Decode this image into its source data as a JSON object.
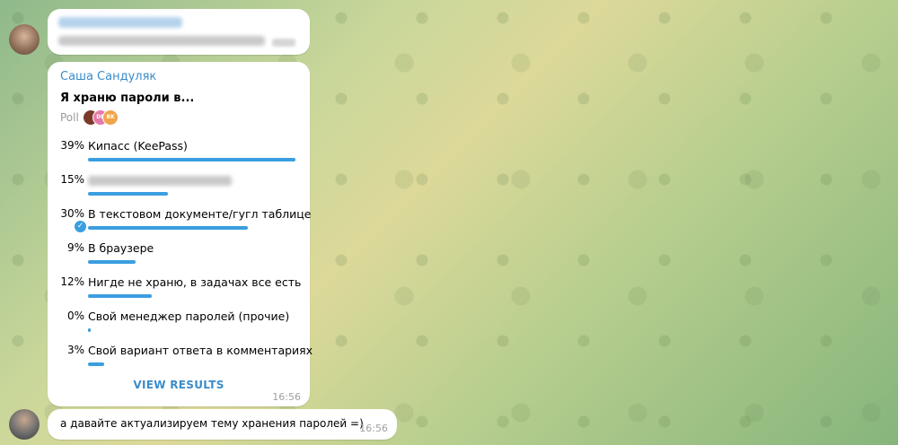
{
  "messages": {
    "prev": {},
    "poll": {
      "sender": "Саша Сандуляк",
      "question": "Я храню пароли в...",
      "type_label": "Poll",
      "voter_avatars": [
        {
          "initials": "",
          "color": "#7a3a2a"
        },
        {
          "initials": "DB",
          "color": "#e57aa8"
        },
        {
          "initials": "BK",
          "color": "#f0a44c"
        }
      ],
      "options": [
        {
          "percent": "39%",
          "value": 39,
          "text": "Кипасс (KeePass)",
          "blurred": false,
          "selected": false
        },
        {
          "percent": "15%",
          "value": 15,
          "text": "",
          "blurred": true,
          "selected": false
        },
        {
          "percent": "30%",
          "value": 30,
          "text": "В текстовом документе/гугл таблице",
          "blurred": false,
          "selected": true
        },
        {
          "percent": "9%",
          "value": 9,
          "text": "В браузере",
          "blurred": false,
          "selected": false
        },
        {
          "percent": "12%",
          "value": 12,
          "text": "Нигде не храню, в задачах все есть",
          "blurred": false,
          "selected": false
        },
        {
          "percent": "0%",
          "value": 0,
          "text": "Свой менеджер паролей (прочие)",
          "blurred": false,
          "selected": false
        },
        {
          "percent": "3%",
          "value": 3,
          "text": "Свой вариант ответа в комментариях",
          "blurred": false,
          "selected": false
        }
      ],
      "view_results_label": "VIEW RESULTS",
      "time": "16:56"
    },
    "reply": {
      "text": "а давайте актуализируем тему хранения паролей =)",
      "time": "16:56"
    }
  },
  "colors": {
    "accent": "#3a9ee0",
    "sender": "#3a8cc9"
  }
}
